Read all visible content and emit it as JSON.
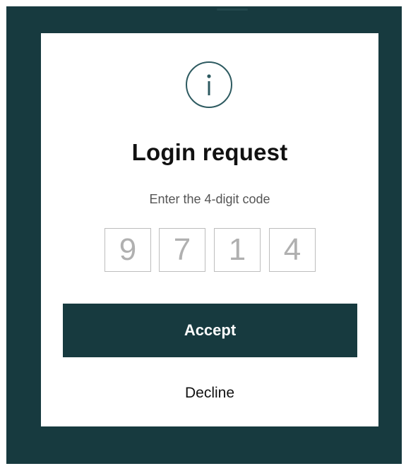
{
  "dialog": {
    "icon": "info-icon",
    "title": "Login request",
    "subtitle": "Enter the 4-digit code",
    "code_digits": [
      "9",
      "7",
      "1",
      "4"
    ],
    "accept_label": "Accept",
    "decline_label": "Decline"
  },
  "colors": {
    "frame_background": "#173a3f",
    "card_background": "#ffffff",
    "accept_button": "#173a3f",
    "digit_text": "#b0b0b0"
  }
}
